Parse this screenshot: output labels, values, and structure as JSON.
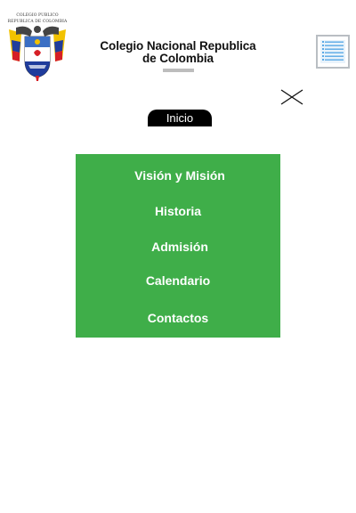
{
  "header": {
    "crest": {
      "top_text": "COLEGIO PUBLICO",
      "sub_text": "REPUBLICA DE COLOMBIA",
      "colors": {
        "gold": "#f2c200",
        "blue": "#1f3c9c",
        "red": "#d61f26"
      }
    },
    "title_line1": "Colegio Nacional Republica",
    "title_line2": "de Colombia",
    "menu_icon": "list-icon",
    "menu_icon_color": "#5aa9e6"
  },
  "close_icon": "close-icon",
  "inicio_label": "Inicio",
  "nav": {
    "background": "#3fae49",
    "items": [
      {
        "label": "Visión y Misión"
      },
      {
        "label": "Historia"
      },
      {
        "label": "Admisión"
      },
      {
        "label": "Calendario"
      },
      {
        "label": "Contactos"
      }
    ]
  }
}
